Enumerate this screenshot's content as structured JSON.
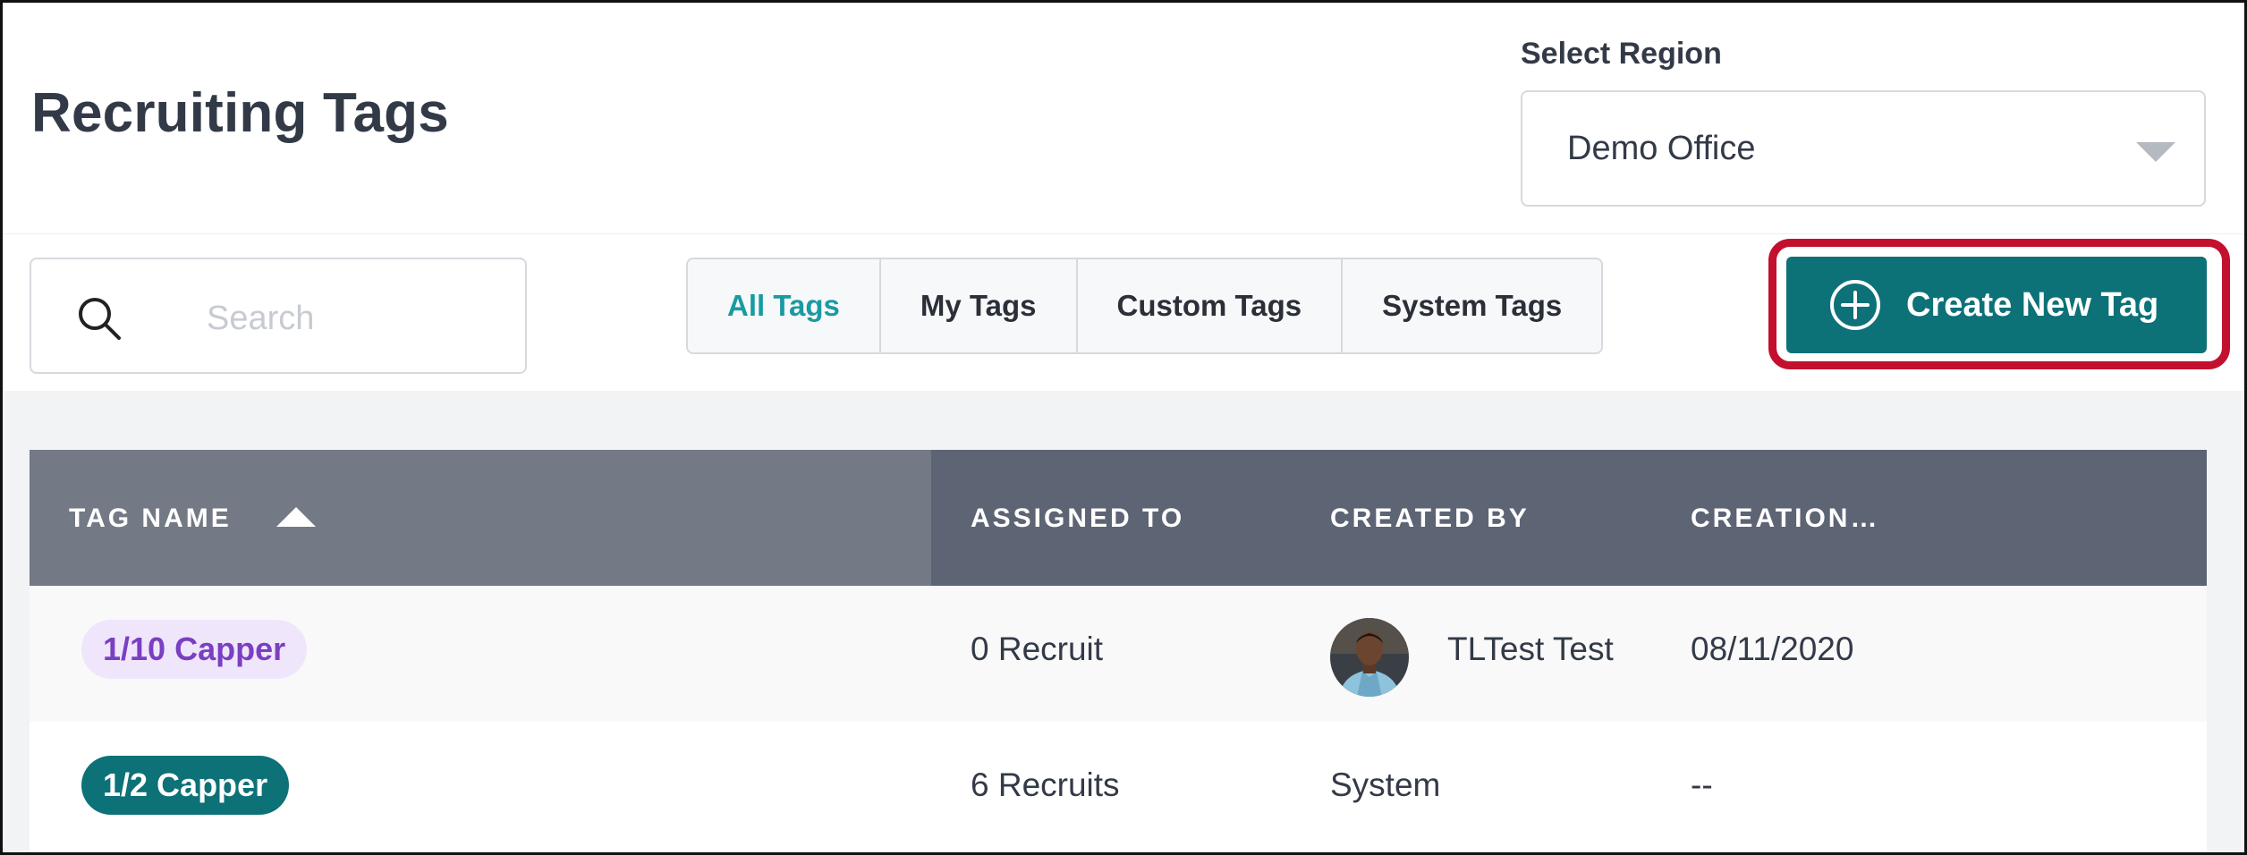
{
  "header": {
    "title": "Recruiting Tags",
    "region_label": "Select Region",
    "region_value": "Demo Office"
  },
  "toolbar": {
    "search_placeholder": "Search",
    "filters": [
      "All Tags",
      "My Tags",
      "Custom Tags",
      "System Tags"
    ],
    "active_filter": "All Tags",
    "create_button": "Create New Tag"
  },
  "table": {
    "columns": [
      "TAG NAME",
      "ASSIGNED TO",
      "CREATED BY",
      "CREATION…"
    ],
    "sort_column": "TAG NAME",
    "sort_direction": "ascending",
    "rows": [
      {
        "tag": "1/10 Capper",
        "tag_style": "purple",
        "assigned": "0 Recruit",
        "creator": "TLTest Test",
        "creator_avatar": true,
        "created": "08/11/2020"
      },
      {
        "tag": "1/2 Capper",
        "tag_style": "teal",
        "assigned": "6 Recruits",
        "creator": "System",
        "creator_avatar": false,
        "created": "--"
      }
    ]
  },
  "colors": {
    "accent": "#0d7178",
    "active_tab": "#1a9aa3",
    "highlight_border": "#c3102e",
    "header_bg": "#5d6474",
    "sorted_header_bg": "#737a86",
    "purple_tag_bg": "#efe6fb",
    "purple_tag_text": "#7a3fc2"
  },
  "icons": {
    "search": "search-icon",
    "create": "plus-circle-icon",
    "region_dropdown": "caret-down-icon",
    "sort": "sort-ascending-icon"
  }
}
